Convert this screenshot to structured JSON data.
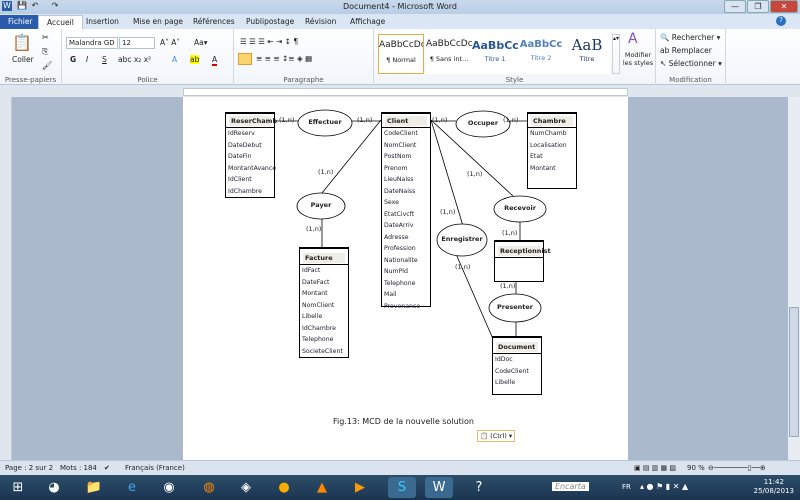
{
  "window": {
    "title": "Document4 - Microsoft Word",
    "minimize": "—",
    "restore": "❐",
    "close": "✕"
  },
  "tabs": [
    "Fichier",
    "Accueil",
    "Insertion",
    "Mise en page",
    "Références",
    "Publipostage",
    "Révision",
    "Affichage"
  ],
  "ribbon": {
    "clipboard": {
      "label": "Presse-papiers",
      "paste": "Coller"
    },
    "font": {
      "label": "Police",
      "name": "Malandra GD",
      "size": "12",
      "bold": "G",
      "italic": "I",
      "underline": "S"
    },
    "paragraph": {
      "label": "Paragraphe"
    },
    "styles": {
      "label": "Style",
      "items": [
        {
          "preview": "AaBbCcDc",
          "name": "¶ Normal"
        },
        {
          "preview": "AaBbCcDc",
          "name": "¶ Sans int..."
        },
        {
          "preview": "AaBbCc",
          "name": "Titre 1"
        },
        {
          "preview": "AaBbCc",
          "name": "Titre 2"
        },
        {
          "preview": "AaB",
          "name": "Titre"
        }
      ],
      "modify": "Modifier les styles"
    },
    "editing": {
      "label": "Modification",
      "find": "Rechercher",
      "replace": "Remplacer",
      "select": "Sélectionner"
    }
  },
  "diagram": {
    "entities": [
      {
        "name": "ReserChamb",
        "fields": [
          "IdReserv",
          "DateDebut",
          "DateFin",
          "MontantAvance",
          "IdClient",
          "IdChambre"
        ]
      },
      {
        "name": "Client",
        "fields": [
          "CodeClient",
          "NomClient",
          "PostNom",
          "Prenom",
          "LieuNaiss",
          "DateNaiss",
          "Sexe",
          "EtatCivcft",
          "DateArriv",
          "Adresse",
          "Profession",
          "Nationalite",
          "NumPld",
          "Telephone",
          "Mail",
          "Provenance"
        ]
      },
      {
        "name": "Chambre",
        "fields": [
          "NumChamb",
          "Localisation",
          "Etat",
          "Montant"
        ]
      },
      {
        "name": "Facture",
        "fields": [
          "IdFact",
          "DateFact",
          "Montant",
          "NomClient",
          "Libelle",
          "IdChambre",
          "Telephone",
          "SocieteClient"
        ]
      },
      {
        "name": "Receptionnist",
        "fields": []
      },
      {
        "name": "Document",
        "fields": [
          "IdDoc",
          "CodeClient",
          "Libelle"
        ]
      }
    ],
    "associations": [
      "Effectuer",
      "Occuper",
      "Payer",
      "Recevoir",
      "Enregistrer",
      "Presenter"
    ],
    "cardinalities": [
      "(1,n)",
      "(1,n)",
      "(1,n)",
      "(1,n)",
      "(1,n)",
      "(1,n)",
      "(1,n)",
      "(1,n)",
      "(1,n)",
      "(1,n)",
      "(1,n)"
    ]
  },
  "caption": "Fig.13: MCD de la nouvelle solution",
  "paste_options": "(Ctrl)",
  "status": {
    "page": "Page : 2 sur 2",
    "words": "Mots : 184",
    "language": "Français (France)",
    "zoom": "90 %"
  },
  "taskbar": {
    "search": "Encarta",
    "lang": "FR",
    "time": "11:42",
    "date": "25/08/2013"
  }
}
